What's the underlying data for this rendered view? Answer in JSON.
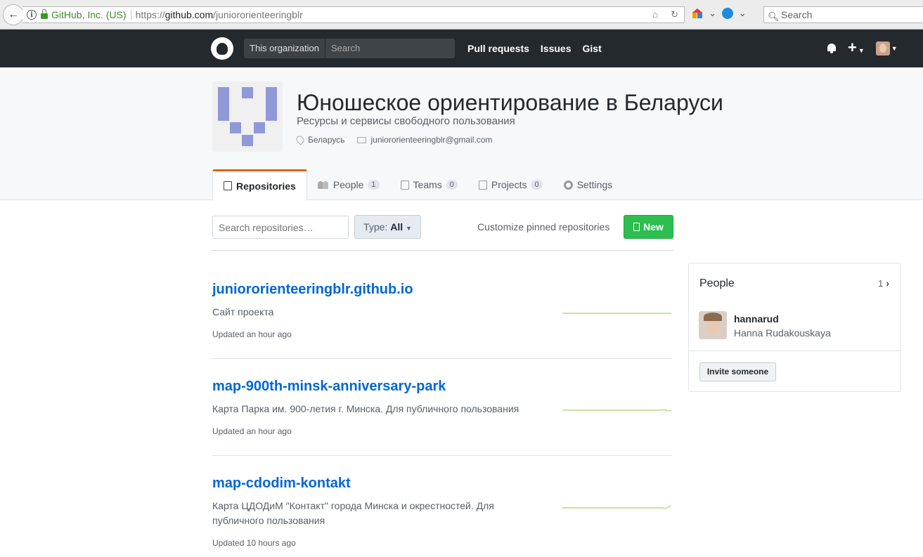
{
  "browser": {
    "site_identity": "GitHub, Inc. (US)",
    "url_prefix": "https://",
    "url_domain": "github.com",
    "url_path": "/juniororienteeringblr",
    "search_placeholder": "Search"
  },
  "header": {
    "scope": "This organization",
    "search_placeholder": "Search",
    "nav": [
      "Pull requests",
      "Issues",
      "Gist"
    ]
  },
  "org": {
    "title": "Юношеское ориентирование в Беларуси",
    "description": "Ресурсы и сервисы свободного пользования",
    "location": "Беларусь",
    "email": "juniororienteeringblr@gmail.com"
  },
  "tabs": [
    {
      "label": "Repositories",
      "count": null
    },
    {
      "label": "People",
      "count": "1"
    },
    {
      "label": "Teams",
      "count": "0"
    },
    {
      "label": "Projects",
      "count": "0"
    },
    {
      "label": "Settings",
      "count": null
    }
  ],
  "filter": {
    "search_placeholder": "Search repositories…",
    "type_label": "Type:",
    "type_value": "All",
    "customize": "Customize pinned repositories",
    "new_label": "New"
  },
  "repos": [
    {
      "name": "juniororienteeringblr.github.io",
      "description": "Сайт проекта",
      "updated": "Updated an hour ago"
    },
    {
      "name": "map-900th-minsk-anniversary-park",
      "description": "Карта Парка им. 900-летия г. Минска. Для публичного пользования",
      "updated": "Updated an hour ago"
    },
    {
      "name": "map-cdodim-kontakt",
      "description": "Карта ЦДОДиМ \"Контакт\" города Минска и окрестностей. Для публичного пользования",
      "updated": "Updated 10 hours ago"
    }
  ],
  "people_box": {
    "title": "People",
    "count": "1",
    "member_login": "hannarud",
    "member_name": "Hanna Rudakouskaya",
    "invite": "Invite someone"
  },
  "colors": {
    "header_bg": "#24292e",
    "link": "#0366d6",
    "new_button": "#2cbe4e",
    "tab_accent": "#e36209",
    "org_avatar": "#8f99d9"
  }
}
